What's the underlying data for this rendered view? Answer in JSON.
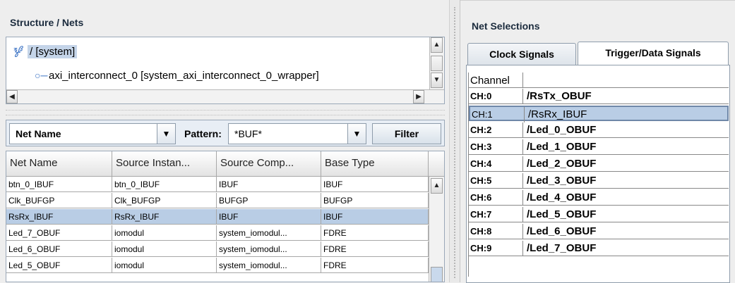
{
  "left": {
    "title": "Structure / Nets",
    "tree": {
      "root_label": "/ [system]",
      "child_label": "axi_interconnect_0 [system_axi_interconnect_0_wrapper]"
    },
    "filter": {
      "field_select": "Net Name",
      "pattern_label": "Pattern:",
      "pattern_value": "*BUF*",
      "filter_button": "Filter"
    },
    "table": {
      "columns": [
        "Net Name",
        "Source Instan...",
        "Source Comp...",
        "Base Type"
      ],
      "rows": [
        [
          "btn_0_IBUF",
          "btn_0_IBUF",
          "IBUF",
          "IBUF"
        ],
        [
          "Clk_BUFGP",
          "Clk_BUFGP",
          "BUFGP",
          "BUFGP"
        ],
        [
          "RsRx_IBUF",
          "RsRx_IBUF",
          "IBUF",
          "IBUF"
        ],
        [
          "Led_7_OBUF",
          "iomodul",
          "system_iomodul...",
          "FDRE"
        ],
        [
          "Led_6_OBUF",
          "iomodul",
          "system_iomodul...",
          "FDRE"
        ],
        [
          "Led_5_OBUF",
          "iomodul",
          "system_iomodul...",
          "FDRE"
        ]
      ],
      "selected_row": 2
    }
  },
  "right": {
    "title": "Net Selections",
    "tabs": [
      "Clock Signals",
      "Trigger/Data Signals"
    ],
    "active_tab": 1,
    "channel_header": "Channel",
    "channels": [
      [
        "CH:0",
        "/RsTx_OBUF"
      ],
      [
        "CH:1",
        "/RsRx_IBUF"
      ],
      [
        "CH:2",
        "/Led_0_OBUF"
      ],
      [
        "CH:3",
        "/Led_1_OBUF"
      ],
      [
        "CH:4",
        "/Led_2_OBUF"
      ],
      [
        "CH:5",
        "/Led_3_OBUF"
      ],
      [
        "CH:6",
        "/Led_4_OBUF"
      ],
      [
        "CH:7",
        "/Led_5_OBUF"
      ],
      [
        "CH:8",
        "/Led_6_OBUF"
      ],
      [
        "CH:9",
        "/Led_7_OBUF"
      ]
    ],
    "selected_channel": 1
  }
}
